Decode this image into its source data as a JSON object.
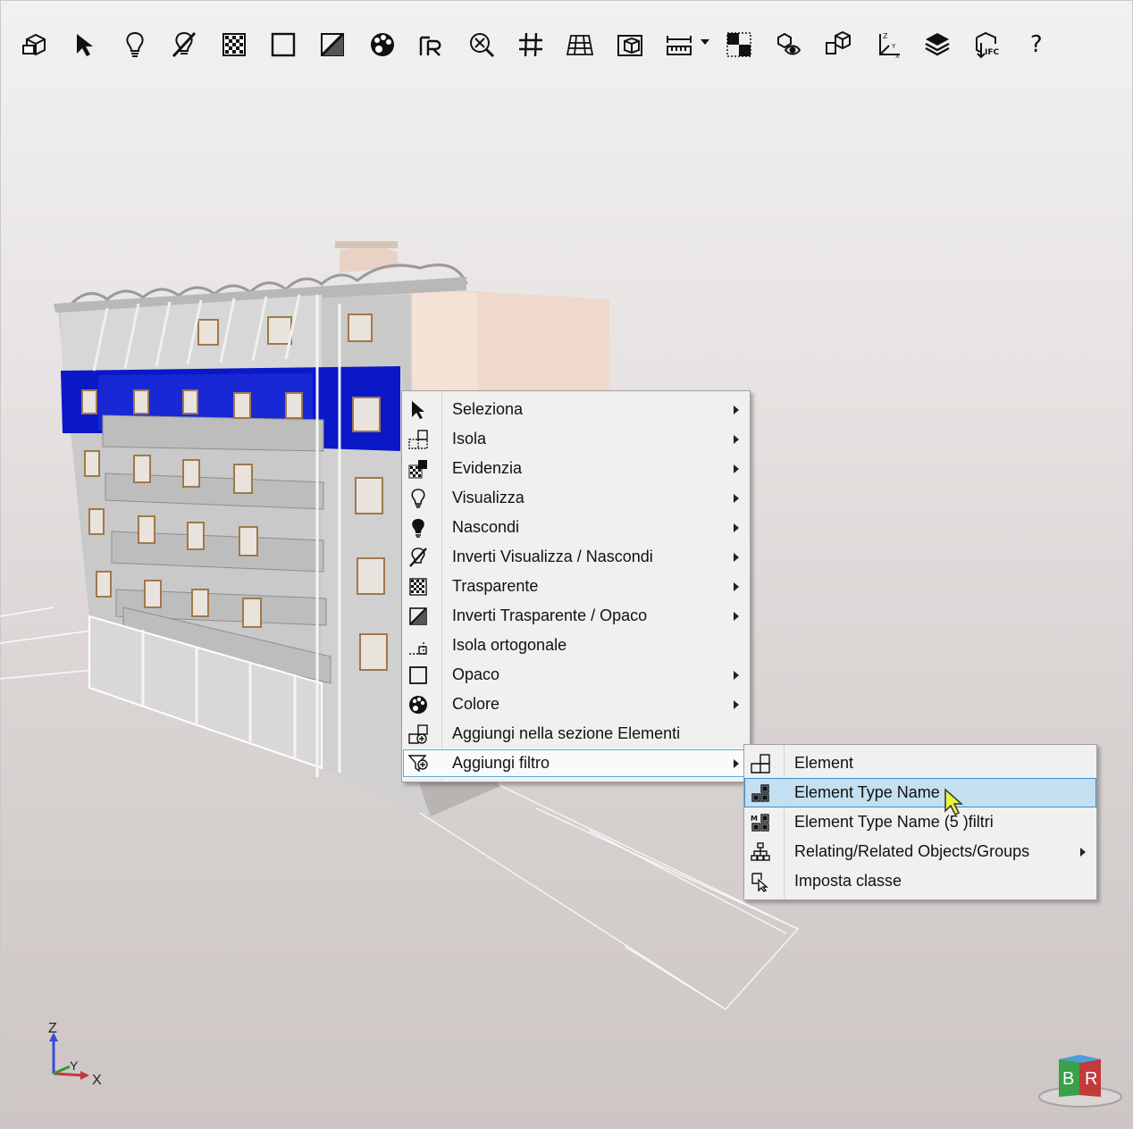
{
  "toolbar": {
    "buttons": [
      {
        "icon": "box-view-icon"
      },
      {
        "icon": "select-arrow-icon"
      },
      {
        "icon": "bulb-show-icon"
      },
      {
        "icon": "invert-visibility-icon"
      },
      {
        "icon": "transparent-icon"
      },
      {
        "icon": "opaque-icon"
      },
      {
        "icon": "invert-transparent-icon"
      },
      {
        "icon": "color-palette-icon"
      },
      {
        "icon": "reset-icon"
      },
      {
        "icon": "zoom-fit-icon"
      },
      {
        "icon": "grid-icon"
      },
      {
        "icon": "plane-grid-icon"
      },
      {
        "icon": "section-box-icon"
      },
      {
        "icon": "measure-icon"
      },
      {
        "icon": "checkerboard-icon"
      },
      {
        "icon": "eye-box-icon"
      },
      {
        "icon": "isometric-icon"
      },
      {
        "icon": "axes-icon"
      },
      {
        "icon": "layers-icon"
      },
      {
        "icon": "ifc-export-icon"
      }
    ],
    "help_label": "?"
  },
  "context_menu": {
    "items": [
      {
        "label": "Seleziona",
        "icon": "select-arrow-icon",
        "submenu": true
      },
      {
        "label": "Isola",
        "icon": "isolate-icon",
        "submenu": true
      },
      {
        "label": "Evidenzia",
        "icon": "highlight-icon",
        "submenu": true
      },
      {
        "label": "Visualizza",
        "icon": "bulb-show-icon",
        "submenu": true
      },
      {
        "label": "Nascondi",
        "icon": "bulb-hide-icon",
        "submenu": true
      },
      {
        "label": "Inverti Visualizza / Nascondi",
        "icon": "invert-visibility-icon",
        "submenu": true
      },
      {
        "label": "Trasparente",
        "icon": "transparent-icon",
        "submenu": true
      },
      {
        "label": "Inverti Trasparente / Opaco",
        "icon": "invert-transparent-icon",
        "submenu": true
      },
      {
        "label": "Isola ortogonale",
        "icon": "orthogonal-isolate-icon",
        "submenu": false
      },
      {
        "label": "Opaco",
        "icon": "opaque-icon",
        "submenu": true
      },
      {
        "label": "Colore",
        "icon": "color-palette-icon",
        "submenu": true
      },
      {
        "label": "Aggiungi nella sezione Elementi",
        "icon": "add-element-icon",
        "submenu": false
      },
      {
        "label": "Aggiungi filtro",
        "icon": "filter-add-icon",
        "submenu": true
      }
    ]
  },
  "filter_submenu": {
    "items": [
      {
        "label": "Element",
        "icon": "element-icon",
        "submenu": false
      },
      {
        "label": "Element Type Name",
        "icon": "type-name-icon",
        "submenu": false,
        "highlighted": true
      },
      {
        "label": "Element Type Name (5 )filtri",
        "icon": "multi-filter-icon",
        "submenu": false
      },
      {
        "label": "Relating/Related Objects/Groups",
        "icon": "hierarchy-icon",
        "submenu": true
      },
      {
        "label": "Imposta classe",
        "icon": "set-class-icon",
        "submenu": false
      }
    ]
  },
  "axes": {
    "z": "Z",
    "y": "Y",
    "x": "X"
  },
  "navcube": {
    "face_left": "B",
    "face_right": "R"
  },
  "colors": {
    "highlight_blue": "#0a18c8",
    "menu_highlight": "#c3dff0",
    "wall_gray": "#c8c8c8",
    "wall_pink": "#efd9cd"
  }
}
